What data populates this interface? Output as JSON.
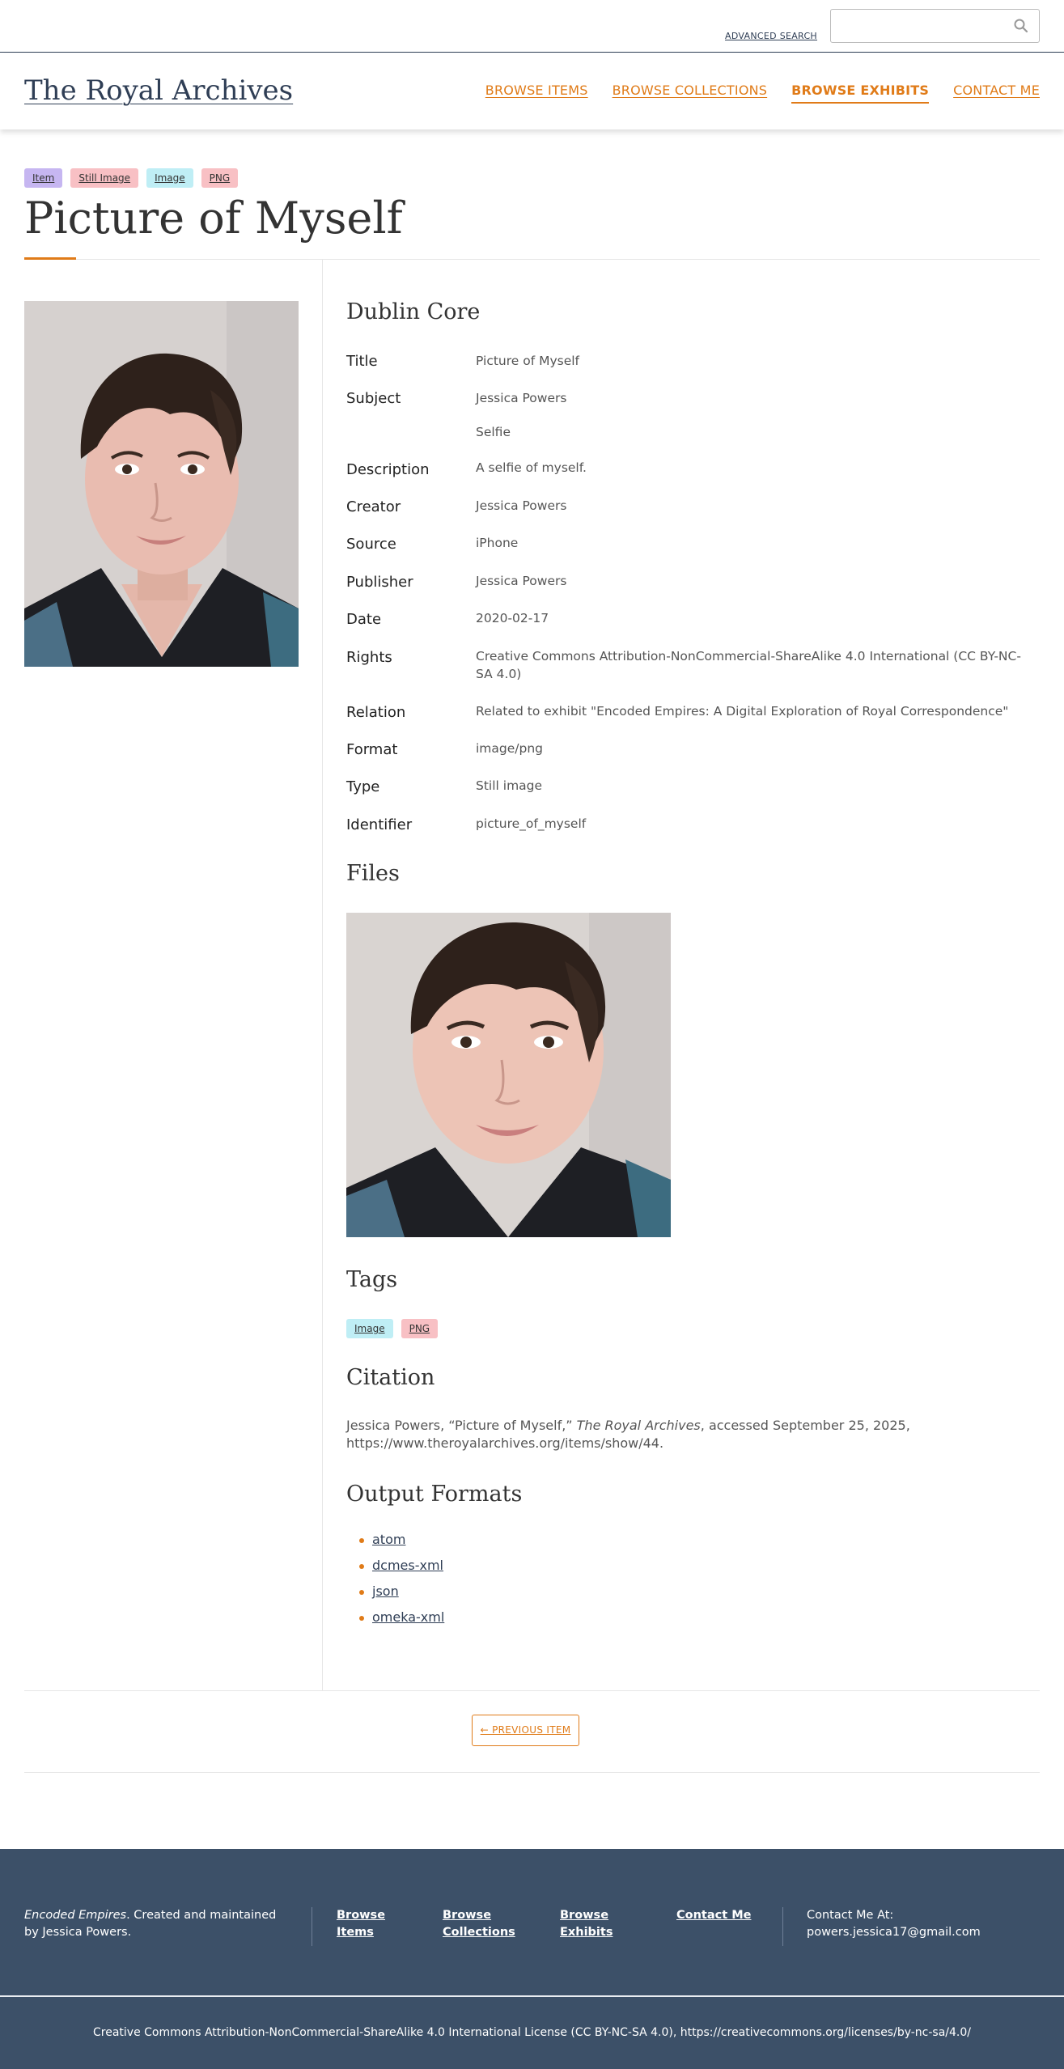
{
  "topbar": {
    "advanced_search": "ADVANCED SEARCH",
    "search_placeholder": ""
  },
  "header": {
    "site_title": "The Royal Archives",
    "nav": [
      {
        "label": "BROWSE ITEMS",
        "active": false
      },
      {
        "label": "BROWSE COLLECTIONS",
        "active": false
      },
      {
        "label": "BROWSE EXHIBITS",
        "active": true
      },
      {
        "label": "CONTACT ME",
        "active": false
      }
    ]
  },
  "item": {
    "badges": [
      "Item",
      "Still Image",
      "Image",
      "PNG"
    ],
    "title": "Picture of Myself"
  },
  "dublin_core": {
    "heading": "Dublin Core",
    "fields": [
      {
        "label": "Title",
        "values": [
          "Picture of Myself"
        ]
      },
      {
        "label": "Subject",
        "values": [
          "Jessica Powers",
          "Selfie"
        ]
      },
      {
        "label": "Description",
        "values": [
          "A selfie of myself."
        ]
      },
      {
        "label": "Creator",
        "values": [
          "Jessica Powers"
        ]
      },
      {
        "label": "Source",
        "values": [
          "iPhone"
        ]
      },
      {
        "label": "Publisher",
        "values": [
          "Jessica Powers"
        ]
      },
      {
        "label": "Date",
        "values": [
          "2020-02-17"
        ]
      },
      {
        "label": "Rights",
        "values": [
          "Creative Commons Attribution-NonCommercial-ShareAlike 4.0 International (CC BY-NC-SA 4.0)"
        ]
      },
      {
        "label": "Relation",
        "values": [
          "Related to exhibit \"Encoded Empires: A Digital Exploration of Royal Correspondence\""
        ]
      },
      {
        "label": "Format",
        "values": [
          "image/png"
        ]
      },
      {
        "label": "Type",
        "values": [
          "Still image"
        ]
      },
      {
        "label": "Identifier",
        "values": [
          "picture_of_myself"
        ]
      }
    ]
  },
  "files": {
    "heading": "Files"
  },
  "tags": {
    "heading": "Tags",
    "items": [
      "Image",
      "PNG"
    ]
  },
  "citation": {
    "heading": "Citation",
    "pre": "Jessica Powers, “Picture of Myself,” ",
    "site": "The Royal Archives",
    "post": ", accessed September 25, 2025, https://www.theroyalarchives.org/items/show/44."
  },
  "output_formats": {
    "heading": "Output Formats",
    "items": [
      "atom",
      "dcmes-xml",
      "json",
      "omeka-xml"
    ]
  },
  "pagination": {
    "previous": "← PREVIOUS ITEM"
  },
  "footer": {
    "about_title": "Encoded Empires",
    "about_text": ". Created and maintained by Jessica Powers.",
    "links": [
      "Browse Items",
      "Browse Collections",
      "Browse Exhibits",
      "Contact Me"
    ],
    "contact_label": "Contact Me At:",
    "contact_email": "powers.jessica17@gmail.com",
    "license": "Creative Commons Attribution-NonCommercial-ShareAlike 4.0 International License (CC BY-NC-SA 4.0), https://creativecommons.org/licenses/by-nc-sa/4.0/"
  },
  "colors": {
    "accent": "#e07b18",
    "navy": "#2f3e55",
    "footer_bg": "#3c5068"
  },
  "icons": [
    "search-icon"
  ]
}
